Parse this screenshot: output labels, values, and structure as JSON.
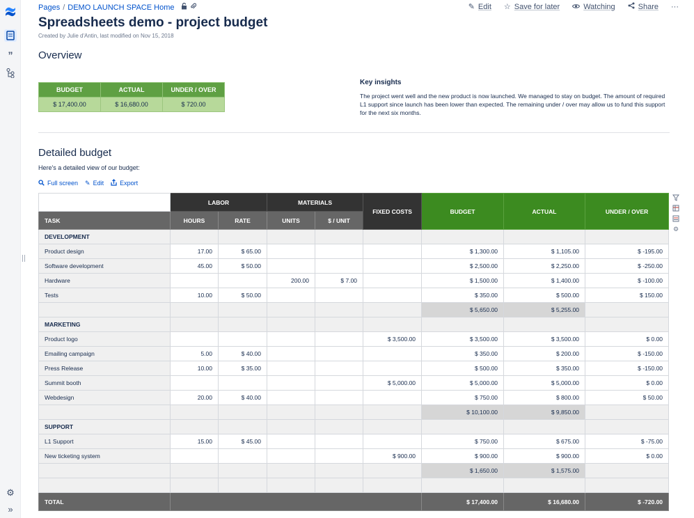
{
  "breadcrumb": {
    "pages": "Pages",
    "separator": "/",
    "space": "DEMO LAUNCH SPACE Home"
  },
  "toolbar": {
    "edit": "Edit",
    "save": "Save for later",
    "watching": "Watching",
    "share": "Share",
    "more": "···"
  },
  "page": {
    "title": "Spreadsheets demo - project budget",
    "byline": "Created by Julie d'Antin, last modified on Nov 15, 2018",
    "overview_heading": "Overview",
    "detailed_heading": "Detailed budget",
    "intro": "Here's a detailed view of our budget:"
  },
  "summary": {
    "headers": [
      "BUDGET",
      "ACTUAL",
      "UNDER / OVER"
    ],
    "values": [
      "$ 17,400.00",
      "$ 16,680.00",
      "$ 720.00"
    ]
  },
  "insights": {
    "heading": "Key insights",
    "text": "The project went well and the new product is now launched. We managed to stay on budget.  The amount of required L1 support since launch has been lower than expected. The remaining under / over may allow us to fund this support for the next six months."
  },
  "actions": {
    "fullscreen": "Full screen",
    "edit": "Edit",
    "export": "Export"
  },
  "budget": {
    "groups": {
      "labor": "LABOR",
      "materials": "MATERIALS",
      "fixed": "FIXED COSTS",
      "budget": "BUDGET",
      "actual": "ACTUAL",
      "under_over": "UNDER / OVER"
    },
    "sub": {
      "task": "TASK",
      "hours": "HOURS",
      "rate": "RATE",
      "units": "UNITS",
      "per_unit": "$ / UNIT"
    },
    "sections": {
      "development": {
        "label": "DEVELOPMENT",
        "rows": [
          [
            "Product design",
            "17.00",
            "$ 65.00",
            "",
            "",
            "",
            "$ 1,300.00",
            "$ 1,105.00",
            "$ -195.00"
          ],
          [
            "Software development",
            "45.00",
            "$ 50.00",
            "",
            "",
            "",
            "$ 2,500.00",
            "$ 2,250.00",
            "$ -250.00"
          ],
          [
            "Hardware",
            "",
            "",
            "200.00",
            "$ 7.00",
            "",
            "$ 1,500.00",
            "$ 1,400.00",
            "$ -100.00"
          ],
          [
            "Tests",
            "10.00",
            "$ 50.00",
            "",
            "",
            "",
            "$ 350.00",
            "$ 500.00",
            "$ 150.00"
          ]
        ],
        "subtotal_budget": "$ 5,650.00",
        "subtotal_actual": "$ 5,255.00"
      },
      "marketing": {
        "label": "MARKETING",
        "rows": [
          [
            "Product logo",
            "",
            "",
            "",
            "",
            "$ 3,500.00",
            "$ 3,500.00",
            "$ 3,500.00",
            "$ 0.00"
          ],
          [
            "Emailing campaign",
            "5.00",
            "$ 40.00",
            "",
            "",
            "",
            "$ 350.00",
            "$ 200.00",
            "$ -150.00"
          ],
          [
            "Press Release",
            "10.00",
            "$ 35.00",
            "",
            "",
            "",
            "$ 500.00",
            "$ 350.00",
            "$ -150.00"
          ],
          [
            "Summit booth",
            "",
            "",
            "",
            "",
            "$ 5,000.00",
            "$ 5,000.00",
            "$ 5,000.00",
            "$ 0.00"
          ],
          [
            "Webdesign",
            "20.00",
            "$ 40.00",
            "",
            "",
            "",
            "$ 750.00",
            "$ 800.00",
            "$ 50.00"
          ]
        ],
        "subtotal_budget": "$ 10,100.00",
        "subtotal_actual": "$ 9,850.00"
      },
      "support": {
        "label": "SUPPORT",
        "rows": [
          [
            "L1 Support",
            "15.00",
            "$ 45.00",
            "",
            "",
            "",
            "$ 750.00",
            "$ 675.00",
            "$ -75.00"
          ],
          [
            "New ticketing system",
            "",
            "",
            "",
            "",
            "$ 900.00",
            "$ 900.00",
            "$ 900.00",
            "$ 0.00"
          ]
        ],
        "subtotal_budget": "$ 1,650.00",
        "subtotal_actual": "$ 1,575.00"
      }
    },
    "total": {
      "label": "TOTAL",
      "budget": "$ 17,400.00",
      "actual": "$ 16,680.00",
      "under_over": "$ -720.00"
    }
  },
  "icons": [
    "confluence-logo-icon",
    "page-icon",
    "quote-icon",
    "tree-icon",
    "settings-icon",
    "expand-icon",
    "lock-icon",
    "attachment-icon",
    "pencil-icon",
    "star-icon",
    "eye-icon",
    "share-icon",
    "search-icon",
    "export-icon",
    "filter-icon",
    "table-icon",
    "chart-icon",
    "gear-icon"
  ]
}
